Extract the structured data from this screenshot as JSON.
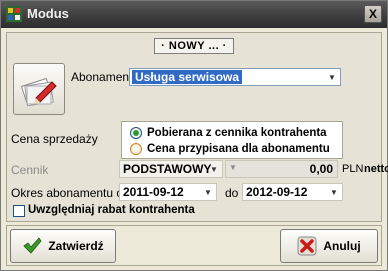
{
  "window": {
    "title": "Modus",
    "close_label": "X"
  },
  "form": {
    "mode_label": "· NOWY ... ·",
    "abonament_label": "Abonament",
    "abonament_value": "Usługa serwisowa",
    "cena_label": "Cena sprzedaży",
    "radio_options": [
      {
        "label": "Pobierana z cennika kontrahenta",
        "checked": true
      },
      {
        "label": "Cena przypisana dla abonamentu",
        "checked": false
      }
    ],
    "cennik_label": "Cennik",
    "cennik_value": "PODSTAWOWY",
    "amount_value": "0,00",
    "currency": "PLN",
    "netto_label": "netto",
    "okres_label": "Okres abonamentu od",
    "date_from": "2011-09-12",
    "do_label": "do",
    "date_to": "2012-09-12",
    "rabat_label": "Uwzględniaj rabat kontrahenta",
    "rabat_checked": false
  },
  "buttons": {
    "confirm_label": "Zatwierdź",
    "cancel_label": "Anuluj"
  },
  "colors": {
    "selection": "#316ac5",
    "confirm_icon": "#3a9a2a",
    "cancel_icon": "#cc1a1a"
  }
}
